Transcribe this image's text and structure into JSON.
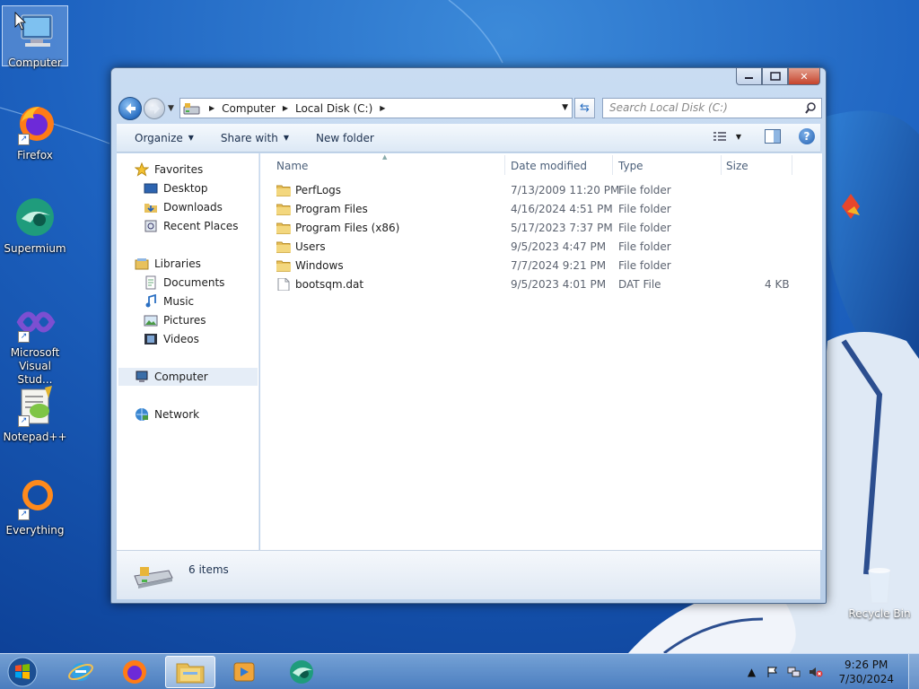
{
  "desktop": {
    "icons": [
      {
        "label": "Computer",
        "icon": "computer-icon"
      },
      {
        "label": "Firefox",
        "icon": "firefox-icon"
      },
      {
        "label": "Supermium",
        "icon": "supermium-icon"
      },
      {
        "label": "Microsoft Visual Stud...",
        "icon": "visual-studio-icon"
      },
      {
        "label": "Notepad++",
        "icon": "notepadpp-icon"
      },
      {
        "label": "Everything",
        "icon": "everything-icon"
      }
    ],
    "recycle_bin": "Recycle Bin"
  },
  "explorer": {
    "breadcrumb": [
      "Computer",
      "Local Disk (C:)"
    ],
    "search_placeholder": "Search Local Disk (C:)",
    "commands": {
      "organize": "Organize",
      "share_with": "Share with",
      "new_folder": "New folder"
    },
    "nav": {
      "favorites": "Favorites",
      "favorites_items": [
        "Desktop",
        "Downloads",
        "Recent Places"
      ],
      "libraries": "Libraries",
      "libraries_items": [
        "Documents",
        "Music",
        "Pictures",
        "Videos"
      ],
      "computer": "Computer",
      "network": "Network"
    },
    "columns": {
      "name": "Name",
      "date": "Date modified",
      "type": "Type",
      "size": "Size"
    },
    "files": [
      {
        "name": "PerfLogs",
        "date": "7/13/2009 11:20 PM",
        "type": "File folder",
        "size": "",
        "kind": "folder"
      },
      {
        "name": "Program Files",
        "date": "4/16/2024 4:51 PM",
        "type": "File folder",
        "size": "",
        "kind": "folder"
      },
      {
        "name": "Program Files (x86)",
        "date": "5/17/2023 7:37 PM",
        "type": "File folder",
        "size": "",
        "kind": "folder"
      },
      {
        "name": "Users",
        "date": "9/5/2023 4:47 PM",
        "type": "File folder",
        "size": "",
        "kind": "folder"
      },
      {
        "name": "Windows",
        "date": "7/7/2024 9:21 PM",
        "type": "File folder",
        "size": "",
        "kind": "folder"
      },
      {
        "name": "bootsqm.dat",
        "date": "9/5/2023 4:01 PM",
        "type": "DAT File",
        "size": "4 KB",
        "kind": "file"
      }
    ],
    "details": {
      "count": "6 items"
    }
  },
  "taskbar": {
    "clock_time": "9:26 PM",
    "clock_date": "7/30/2024",
    "pinned": [
      "internet-explorer-icon",
      "firefox-icon",
      "file-explorer-icon",
      "media-player-icon",
      "supermium-icon"
    ]
  },
  "colors": {
    "desktop_blue": "#1e5fb8",
    "selection": "#e5edf7"
  }
}
